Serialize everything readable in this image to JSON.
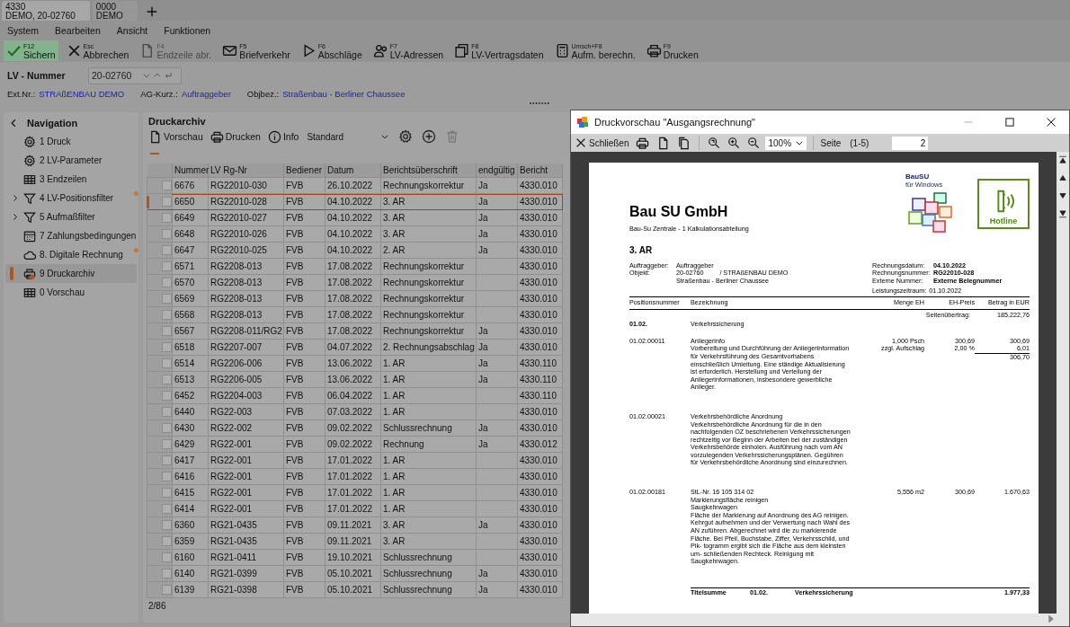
{
  "doc_tabs": [
    {
      "line1": "4330",
      "line2": "DEMO, 20-02760",
      "selected": true
    },
    {
      "line1": "0000",
      "line2": "DEMO",
      "selected": false
    }
  ],
  "menu": [
    "System",
    "Bearbeiten",
    "Ansicht",
    "Funktionen"
  ],
  "toolbar": [
    {
      "kind": "check",
      "key": "F12",
      "label": "Sichern",
      "active": true,
      "disabled": false
    },
    {
      "kind": "close",
      "key": "Esc",
      "label": "Abbrechen",
      "active": false,
      "disabled": false
    },
    {
      "kind": "doc",
      "key": "F4",
      "label": "Endzeile abr.",
      "active": false,
      "disabled": true
    },
    {
      "kind": "mail",
      "key": "F5",
      "label": "Briefverkehr",
      "active": false,
      "disabled": false
    },
    {
      "kind": "play",
      "key": "F6",
      "label": "Abschläge",
      "active": false,
      "disabled": false
    },
    {
      "kind": "people",
      "key": "F7",
      "label": "LV-Adressen",
      "active": false,
      "disabled": false
    },
    {
      "kind": "pages",
      "key": "F8",
      "label": "LV-Vertragsdaten",
      "active": false,
      "disabled": false
    },
    {
      "kind": "calc",
      "key": "Umsch+F8",
      "label": "Aufm. berechn.",
      "active": false,
      "disabled": false
    },
    {
      "kind": "print",
      "key": "F9",
      "label": "Drucken",
      "active": false,
      "disabled": false
    }
  ],
  "lv": {
    "label": "LV - Nummer",
    "value": "20-02760"
  },
  "info": [
    {
      "label": "Ext.Nr.:",
      "value": "STRAßENBAU DEMO"
    },
    {
      "label": "AG-Kurz.:",
      "value": "Auftraggeber"
    },
    {
      "label": "Objbez.:",
      "value": "Straßenbau - Berliner Chaussee"
    }
  ],
  "navigation": {
    "title": "Navigation",
    "items": [
      {
        "kind": "gear",
        "label": "1 Druck",
        "collapsible": false,
        "marked": false,
        "selected": false
      },
      {
        "kind": "gear",
        "label": "2 LV-Parameter",
        "collapsible": false,
        "marked": false,
        "selected": false
      },
      {
        "kind": "grid",
        "label": "3 Endzeilen",
        "collapsible": false,
        "marked": false,
        "selected": false
      },
      {
        "kind": "filter",
        "label": "4 LV-Positionsfilter",
        "collapsible": true,
        "marked": true,
        "selected": false
      },
      {
        "kind": "filter",
        "label": "5 Aufmaßfilter",
        "collapsible": true,
        "marked": false,
        "selected": false
      },
      {
        "kind": "calendar",
        "label": "7 Zahlungsbedingungen",
        "collapsible": false,
        "marked": false,
        "selected": false
      },
      {
        "kind": "cloud",
        "label": "8. Digitale Rechnung",
        "collapsible": false,
        "marked": true,
        "selected": false
      },
      {
        "kind": "archive",
        "label": "9 Druckarchiv",
        "collapsible": false,
        "marked": false,
        "selected": true
      },
      {
        "kind": "grid",
        "label": "0 Vorschau",
        "collapsible": false,
        "marked": false,
        "selected": false
      }
    ]
  },
  "archive": {
    "title": "Druckarchiv",
    "actions": [
      {
        "kind": "doc",
        "label": "Vorschau"
      },
      {
        "kind": "print",
        "label": "Drucken"
      },
      {
        "kind": "info",
        "label": "Info"
      }
    ],
    "layout": "Standard",
    "icon_buttons": [
      {
        "kind": "gear",
        "disabled": false
      },
      {
        "kind": "plus",
        "disabled": false
      },
      {
        "kind": "trash",
        "disabled": true
      }
    ],
    "columns": [
      "Nummer",
      "LV Rg-Nr",
      "Bediener",
      "Datum",
      "Berichtsüberschrift",
      "endgültig",
      "Bericht"
    ],
    "rows": [
      {
        "cells": [
          "6676",
          "RG22010-030",
          "FVB",
          "26.10.2022",
          "Rechnungskorrektur",
          "Ja",
          "4330.010"
        ],
        "checked": false,
        "selected": false
      },
      {
        "cells": [
          "6650",
          "RG22010-028",
          "FVB",
          "04.10.2022",
          "3. AR",
          "Ja",
          "4330.010"
        ],
        "checked": false,
        "selected": true
      },
      {
        "cells": [
          "6649",
          "RG22010-027",
          "FVB",
          "04.10.2022",
          "3. AR",
          "Ja",
          "4330.010"
        ],
        "checked": false,
        "selected": false
      },
      {
        "cells": [
          "6648",
          "RG22010-026",
          "FVB",
          "04.10.2022",
          "3. AR",
          "Ja",
          "4330.010"
        ],
        "checked": false,
        "selected": false
      },
      {
        "cells": [
          "6647",
          "RG22010-025",
          "FVB",
          "04.10.2022",
          "2. AR",
          "Ja",
          "4330.010"
        ],
        "checked": false,
        "selected": false
      },
      {
        "cells": [
          "6571",
          "RG2208-013",
          "FVB",
          "17.08.2022",
          "Rechnungskorrektur",
          null,
          "4330.010"
        ],
        "checked": false,
        "selected": false
      },
      {
        "cells": [
          "6570",
          "RG2208-013",
          "FVB",
          "17.08.2022",
          "Rechnungskorrektur",
          null,
          "4330.010"
        ],
        "checked": false,
        "selected": false
      },
      {
        "cells": [
          "6569",
          "RG2208-013",
          "FVB",
          "17.08.2022",
          "Rechnungskorrektur",
          null,
          "4330.010"
        ],
        "checked": false,
        "selected": false
      },
      {
        "cells": [
          "6568",
          "RG2208-013",
          "FVB",
          "17.08.2022",
          "Rechnungskorrektur",
          null,
          "4330.010"
        ],
        "checked": false,
        "selected": false
      },
      {
        "cells": [
          "6567",
          "RG2208-011/RG2",
          "FVB",
          "17.08.2022",
          "Rechnungskorrektur",
          "Ja",
          "4330.010"
        ],
        "checked": false,
        "selected": false
      },
      {
        "cells": [
          "6518",
          "RG2207-007",
          "FVB",
          "04.07.2022",
          "2. Rechnungsabschlag",
          "Ja",
          "4330.010"
        ],
        "checked": false,
        "selected": false
      },
      {
        "cells": [
          "6514",
          "RG2206-006",
          "FVB",
          "13.06.2022",
          "1. AR",
          "Ja",
          "4330.110"
        ],
        "checked": false,
        "selected": false
      },
      {
        "cells": [
          "6513",
          "RG2206-005",
          "FVB",
          "13.06.2022",
          "1. AR",
          "Ja",
          "4330.110"
        ],
        "checked": false,
        "selected": false
      },
      {
        "cells": [
          "6452",
          "RG2204-003",
          "FVB",
          "06.04.2022",
          "1. AR",
          null,
          "4330.110"
        ],
        "checked": false,
        "selected": false
      },
      {
        "cells": [
          "6440",
          "RG22-003",
          "FVB",
          "07.03.2022",
          "1. AR",
          null,
          "4330.010"
        ],
        "checked": false,
        "selected": false
      },
      {
        "cells": [
          "6430",
          "RG22-002",
          "FVB",
          "09.02.2022",
          "Schlussrechnung",
          "Ja",
          "4330.010"
        ],
        "checked": false,
        "selected": false
      },
      {
        "cells": [
          "6429",
          "RG22-001",
          "FVB",
          "09.02.2022",
          "Rechnung",
          "Ja",
          "4330.012"
        ],
        "checked": false,
        "selected": false
      },
      {
        "cells": [
          "6417",
          "RG22-001",
          "FVB",
          "17.01.2022",
          "1. AR",
          null,
          "4330.010"
        ],
        "checked": false,
        "selected": false
      },
      {
        "cells": [
          "6416",
          "RG22-001",
          "FVB",
          "17.01.2022",
          "1. AR",
          null,
          "4330.010"
        ],
        "checked": false,
        "selected": false
      },
      {
        "cells": [
          "6415",
          "RG22-001",
          "FVB",
          "17.01.2022",
          "1. AR",
          null,
          "4330.010"
        ],
        "checked": false,
        "selected": false
      },
      {
        "cells": [
          "6414",
          "RG22-001",
          "FVB",
          "17.01.2022",
          "1. AR",
          null,
          "4330.010"
        ],
        "checked": false,
        "selected": false
      },
      {
        "cells": [
          "6360",
          "RG21-0435",
          "FVB",
          "09.11.2021",
          "3. AR",
          "Ja",
          "4330.010"
        ],
        "checked": false,
        "selected": false
      },
      {
        "cells": [
          "6359",
          "RG21-0435",
          "FVB",
          "09.11.2021",
          "3. AR",
          null,
          "4330.010"
        ],
        "checked": false,
        "selected": false
      },
      {
        "cells": [
          "6160",
          "RG21-0411",
          "FVB",
          "19.10.2021",
          "Schlussrechnung",
          null,
          "4330.010"
        ],
        "checked": false,
        "selected": false
      },
      {
        "cells": [
          "6140",
          "RG21-0399",
          "FVB",
          "05.10.2021",
          "Schlussrechnung",
          "Ja",
          "4330.010"
        ],
        "checked": false,
        "selected": false
      },
      {
        "cells": [
          "6139",
          "RG21-0398",
          "FVB",
          "05.10.2021",
          "Schlussrechnung",
          "Ja",
          "4330.010"
        ],
        "checked": false,
        "selected": false
      }
    ],
    "record_count": "2/86"
  },
  "preview": {
    "title": "Druckvorschau \"Ausgangsrechnung\"",
    "close_label": "Schließen",
    "zoom": "100%",
    "page_label": "Seite",
    "page_range": "(1-5)",
    "page": "2",
    "document": {
      "company": "Bau SU GmbH",
      "subtitle": "Bau-Su Zentrale - 1 Kalkulationsabteilung",
      "logo_title": "BauSU",
      "logo_subtitle": "für Windows",
      "hotline": "Hotline",
      "heading": "3. AR",
      "client": {
        "label": "Auftraggeber:",
        "value": "Auftraggeber"
      },
      "object": {
        "label": "Objekt:",
        "number": "20-02760",
        "name": "/ STRAßENBAU DEMO",
        "detail": "Straßenbau - Berliner Chaussee"
      },
      "invoice": [
        {
          "label": "Rechnungsdatum:",
          "value": "04.10.2022"
        },
        {
          "label": "Rechnungsnummer:",
          "value": "RG22010-028"
        },
        {
          "label": "Externe Nummer:",
          "value": "Externe Belegnummer"
        }
      ],
      "period": {
        "label": "Leistungszeitraum:",
        "value": "01.10.2022"
      },
      "columns": [
        "Positionsnummer",
        "Bezeichnung",
        "Menge EH",
        "EH-Preis",
        "Betrag in EUR"
      ],
      "carry": {
        "label": "Seitenübertrag:",
        "value": "185.222,76"
      },
      "section": {
        "number": "01.02.",
        "title": "Verkehrssicherung"
      },
      "positions": [
        {
          "number": "01.02.00011",
          "text": "Anliegerinfo\nVorbereitung und Durchführung der Anliegerinformation\nfür Verkehrsführung des Gesamtvorhabens\neinschließlich Umleitung. Eine ständige Aktualisierung\nist erforderlich. Herstellung und Verteilung der\nAnliegerinformationen, insbesondere gewerbliche\nAnlieger.",
          "quantity": "1,000 Psch",
          "price": "300,69",
          "amount": "300,69",
          "surcharge": {
            "label": "zzgl. Aufschlag",
            "rate": "2,00 %",
            "amount": "6,01"
          },
          "subtotal": "306,70"
        },
        {
          "number": "01.02.00021",
          "text": "Verkehrsbehördliche Anordnung\nVerkehrsbehördliche Anordnung für die in den\nnachfolgenden OZ beschriebenen Verkehrssicherungen\nrechtzeitig vor Beginn der Arbeiten bei der zuständigen\nVerkehrsbehörde einholen. Ausführung nach vom AN\nvorzulegenden Verkehrssicherungsplänen. Gegühren\nfür Verkehrsbehördliche Anordnung sind einzurechnen."
        },
        {
          "number": "01.02.00181",
          "text": "StL-Nr. 16 105 314 02\nMarkierungsfläche reinigen\nSaugkehrwagen\nFläche der Markierung auf Anordnung des AG reinigen.\nKehrgut aufnehmen und der Verwertung nach Wahl des\nAN zuführen. Abgerechnet wird die zu markierende\nFläche. Bei Pfeil, Buchstabe, Ziffer, Verkehrsschild, und\nPik- togramm ergibt sich die Fläche aus dem kleinsten\num- schließenden Rechteck. Reinigung mit\nSaugkehrwagen.",
          "quantity": "5,556 m2",
          "price": "300,69",
          "amount": "1.670,63"
        }
      ],
      "total": {
        "label": "Titelsumme",
        "number": "01.02.",
        "title": "Verkehrssicherung",
        "amount": "1.977,33"
      }
    }
  }
}
